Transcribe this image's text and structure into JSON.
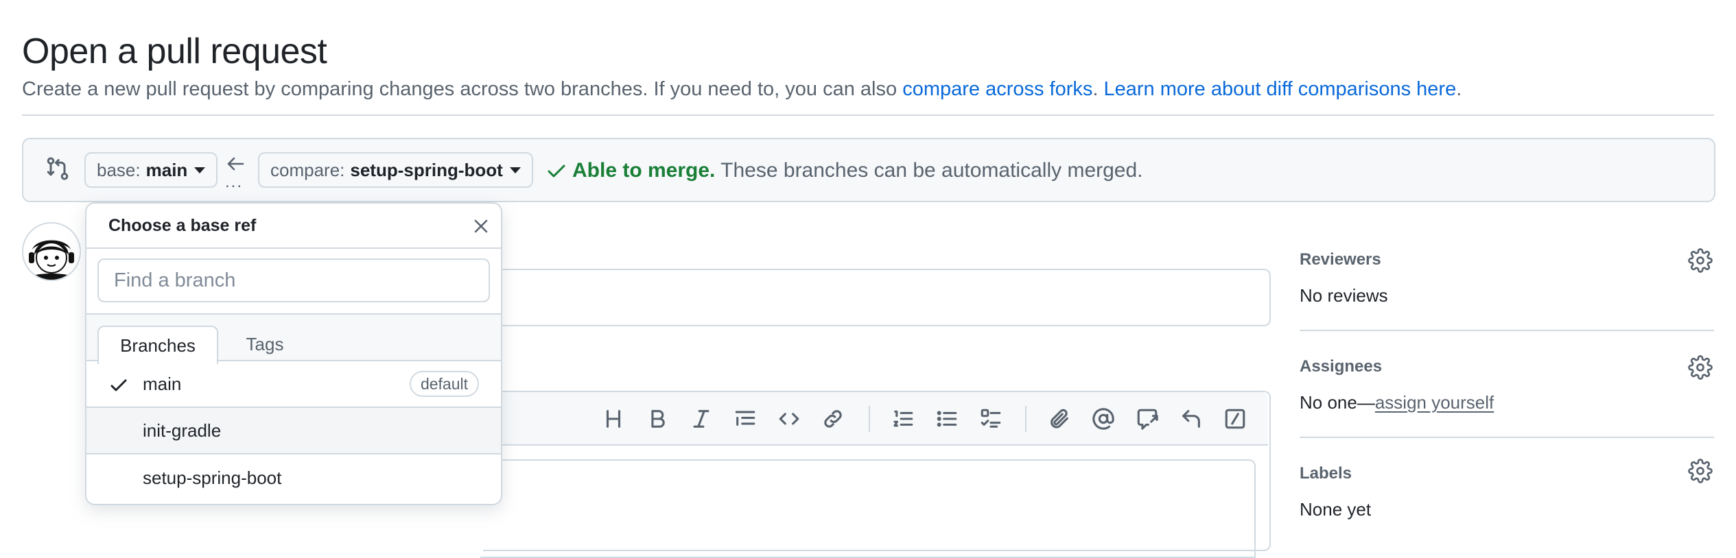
{
  "page": {
    "title": "Open a pull request",
    "subtitle_text": "Create a new pull request by comparing changes across two branches. If you need to, you can also ",
    "compare_forks_link": "compare across forks",
    "sep": ". ",
    "learn_more_link": "Learn more about diff comparisons here",
    "end": "."
  },
  "range": {
    "base_label": "base:",
    "base_value": "main",
    "compare_label": "compare:",
    "compare_value": "setup-spring-boot",
    "dots": "...",
    "merge_ok": "Able to merge.",
    "merge_rest": " These branches can be automatically merged."
  },
  "dropdown": {
    "title": "Choose a base ref",
    "search_placeholder": "Find a branch",
    "tabs": [
      "Branches",
      "Tags"
    ],
    "items": [
      {
        "name": "main",
        "selected": true,
        "badge": "default"
      },
      {
        "name": "init-gradle",
        "selected": false,
        "badge": ""
      },
      {
        "name": "setup-spring-boot",
        "selected": false,
        "badge": ""
      }
    ]
  },
  "editor": {
    "toolbar_icons": [
      "heading-icon",
      "bold-icon",
      "italic-icon",
      "quote-icon",
      "code-icon",
      "link-icon",
      "ordered-list-icon",
      "unordered-list-icon",
      "task-list-icon",
      "attach-icon",
      "mention-icon",
      "reference-icon",
      "reply-icon",
      "slash-command-icon"
    ]
  },
  "sidebar": {
    "reviewers": {
      "heading": "Reviewers",
      "value": "No reviews"
    },
    "assignees": {
      "heading": "Assignees",
      "value_prefix": "No one—",
      "value_link": "assign yourself"
    },
    "labels": {
      "heading": "Labels",
      "value": "None yet"
    }
  },
  "colors": {
    "link": "#0969da",
    "success": "#1a7f37",
    "muted": "#59636e",
    "border": "#d1d9e0"
  }
}
